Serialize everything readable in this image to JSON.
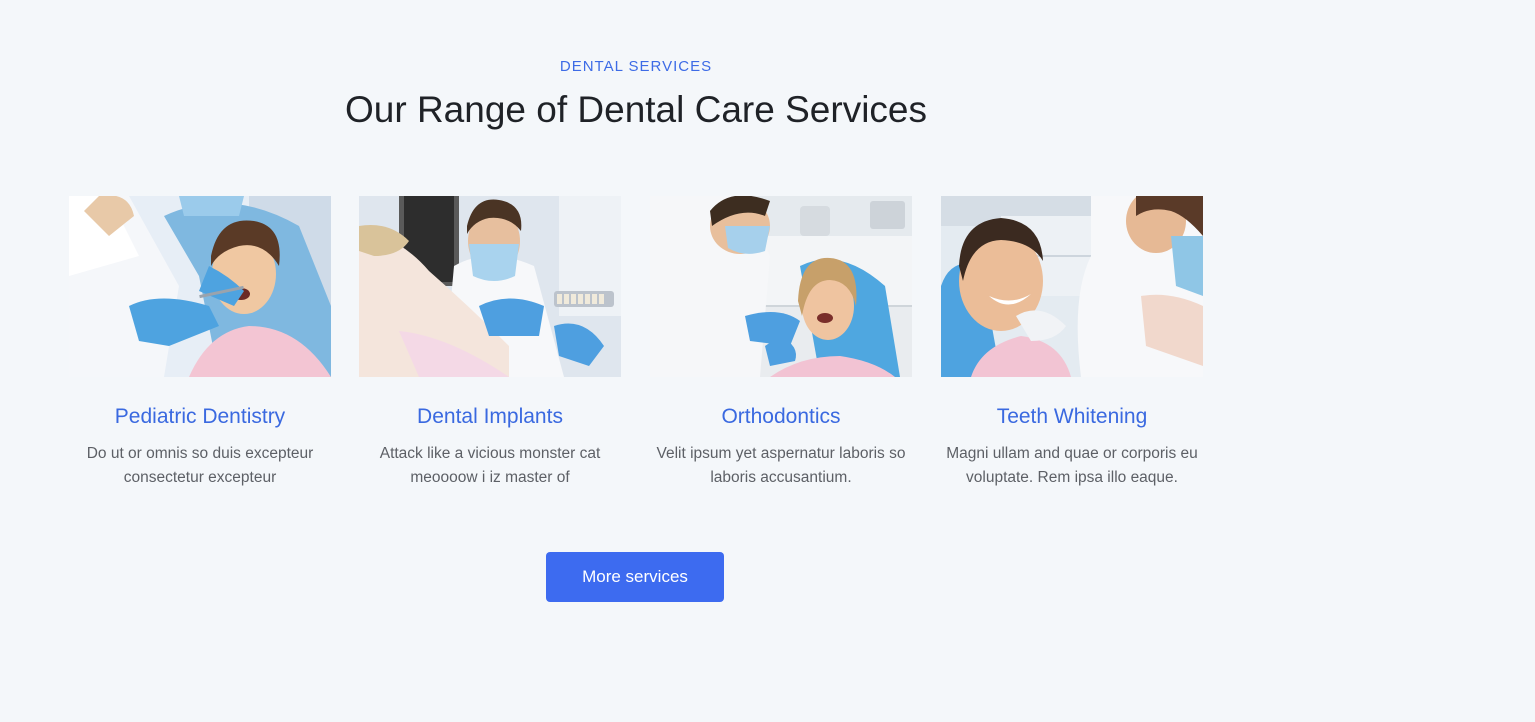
{
  "section": {
    "eyebrow": "DENTAL SERVICES",
    "heading": "Our Range of Dental Care Services"
  },
  "services": [
    {
      "title": "Pediatric Dentistry",
      "description": "Do ut or omnis so duis excepteur consectetur excepteur",
      "image_subject": "dentist examining a child patient"
    },
    {
      "title": "Dental Implants",
      "description": "Attack like a vicious monster cat meoooow i iz master of",
      "image_subject": "dentist holding shade guide near patient"
    },
    {
      "title": "Orthodontics",
      "description": "Velit ipsum yet aspernatur laboris so laboris accusantium.",
      "image_subject": "dentist examining a woman in the chair"
    },
    {
      "title": "Teeth Whitening",
      "description": "Magni ullam and quae or corporis eu voluptate. Rem ipsa illo eaque.",
      "image_subject": "smiling man with white teeth"
    }
  ],
  "cta": {
    "label": "More services"
  },
  "colors": {
    "background": "#f4f7fa",
    "accent": "#3d6be6",
    "button": "#3d6bf0",
    "heading": "#1f2227",
    "body_text": "#5d6066"
  }
}
